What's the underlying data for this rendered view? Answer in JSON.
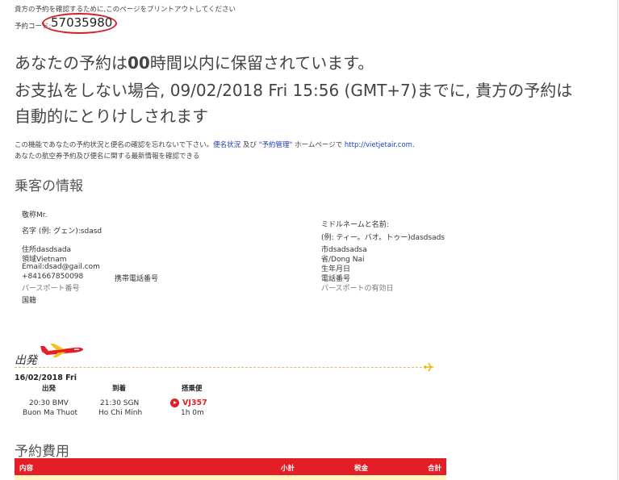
{
  "header": {
    "print_note": "貴方の予約を確認するために,このページをプリントアウトしてください",
    "booking_code_label": "予約コード:",
    "booking_code": "57035980"
  },
  "hold": {
    "line1_prefix": "あなたの予約は",
    "line1_hours": "00",
    "line1_suffix": "時間以内に保留されています。",
    "line2": "お支払をしない場合, 09/02/2018 Fri 15:56 (GMT+7)までに, 貴方の予約は",
    "line3": "自動的にとりけしされます"
  },
  "info": {
    "line1_a": "この機能であなたの予約状況と便名の確認を忘れないで下さい。",
    "link1": "便名状況",
    "line1_b": " 及び ",
    "link2": "\"予約管理\"",
    "line1_c": " ホームページで ",
    "link3": "http://vietjetair.com",
    "line1_d": ".",
    "line2": "あなたの航空券予約及び便名に関する最新情報を確認できる"
  },
  "passenger": {
    "section_title": "乗客の情報",
    "title": "敬称Mr.",
    "first_name": "名字 (例: グェン):sdasd",
    "middle_last_label": "ミドルネームと名前:",
    "middle_last": "(例: ティー。バオ。トゥー)dasdsads",
    "address": "住所dasdsada",
    "city": "市dsadsadsa",
    "country": "領域Vietnam",
    "province": "省/Dong Nai",
    "email": "Email:dsad@gail.com",
    "birthday": "生年月日",
    "phone": "+841667850098",
    "mobile_label": "携帯電話番号",
    "phone_label": "電話番号",
    "passport_label": "パースポート番号",
    "passport_expiry_label": "パースポートの有効日",
    "nationality_label": "国籍"
  },
  "departure": {
    "label": "出発",
    "date": "16/02/2018 Fri",
    "col_depart": "出発",
    "col_arrive": "到着",
    "col_flight": "搭乗便",
    "depart_time": "20:30 BMV",
    "depart_city": "Buon Ma Thuot",
    "arrive_time": "21:30 SGN",
    "arrive_city": "Ho Chi Minh",
    "flight_no": "VJ357",
    "duration": "1h 0m"
  },
  "fees": {
    "section_title": "予約費用",
    "col_content": "内容",
    "col_subtotal": "小計",
    "col_tax": "税金",
    "col_total": "合計"
  },
  "colors": {
    "accent_red": "#e31e26",
    "link_blue": "#1a3fc4",
    "dash_yellow": "#e2c24a"
  }
}
